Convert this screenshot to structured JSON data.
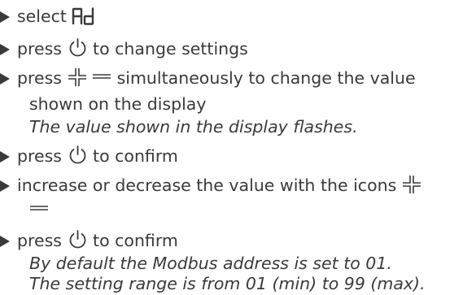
{
  "steps": [
    {
      "text_before": "select"
    },
    {
      "text_before": "press",
      "text_after": "to change settings"
    },
    {
      "text_before": "press",
      "text_after": "simultaneously to change the value",
      "text_line2": "shown on the display",
      "note": "The value shown in the display flashes."
    },
    {
      "text_before": "press",
      "text_after": "to confirm"
    },
    {
      "text_before": "increase or decrease the value with the icons"
    },
    {
      "text_before": "press",
      "text_after": "to confirm",
      "note_line1": "By default the Modbus address is set to 01.",
      "note_line2": "The setting range is from 01 (min) to 99 (max)."
    }
  ],
  "icons": {
    "display_code": "seven-segment-Ad-icon",
    "power": "power-icon",
    "plus": "plus-icon",
    "minus": "minus-icon"
  },
  "colors": {
    "text": "#3a3a3a"
  }
}
